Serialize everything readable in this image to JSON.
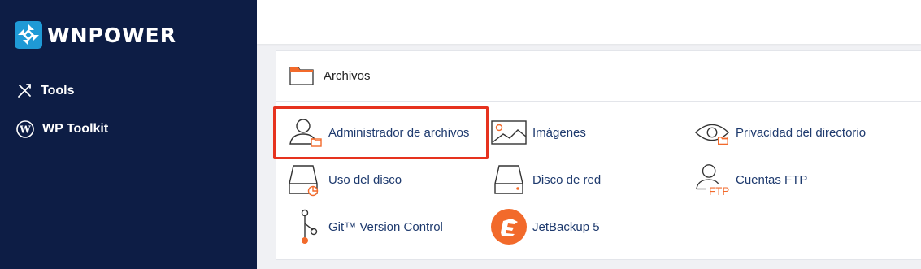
{
  "brand": {
    "name": "WNPOWER",
    "logo_color": "#1f9ad6"
  },
  "sidebar": {
    "items": [
      {
        "label": "Tools",
        "icon": "tools-icon"
      },
      {
        "label": "WP Toolkit",
        "icon": "wordpress-icon"
      }
    ]
  },
  "section": {
    "title": "Archivos",
    "items": [
      {
        "label": "Administrador de archivos",
        "icon": "file-manager-icon",
        "highlighted": true
      },
      {
        "label": "Imágenes",
        "icon": "images-icon"
      },
      {
        "label": "Privacidad del directorio",
        "icon": "directory-privacy-icon"
      },
      {
        "label": "Uso del disco",
        "icon": "disk-usage-icon"
      },
      {
        "label": "Disco de red",
        "icon": "network-disk-icon"
      },
      {
        "label": "Cuentas FTP",
        "icon": "ftp-accounts-icon"
      },
      {
        "label": "Git™ Version Control",
        "icon": "git-icon"
      },
      {
        "label": "JetBackup 5",
        "icon": "jetbackup-icon"
      }
    ]
  },
  "colors": {
    "sidebar_bg": "#0d1d45",
    "accent": "#f26a2b",
    "link": "#1e3a6e",
    "highlight_border": "#e6321e"
  }
}
